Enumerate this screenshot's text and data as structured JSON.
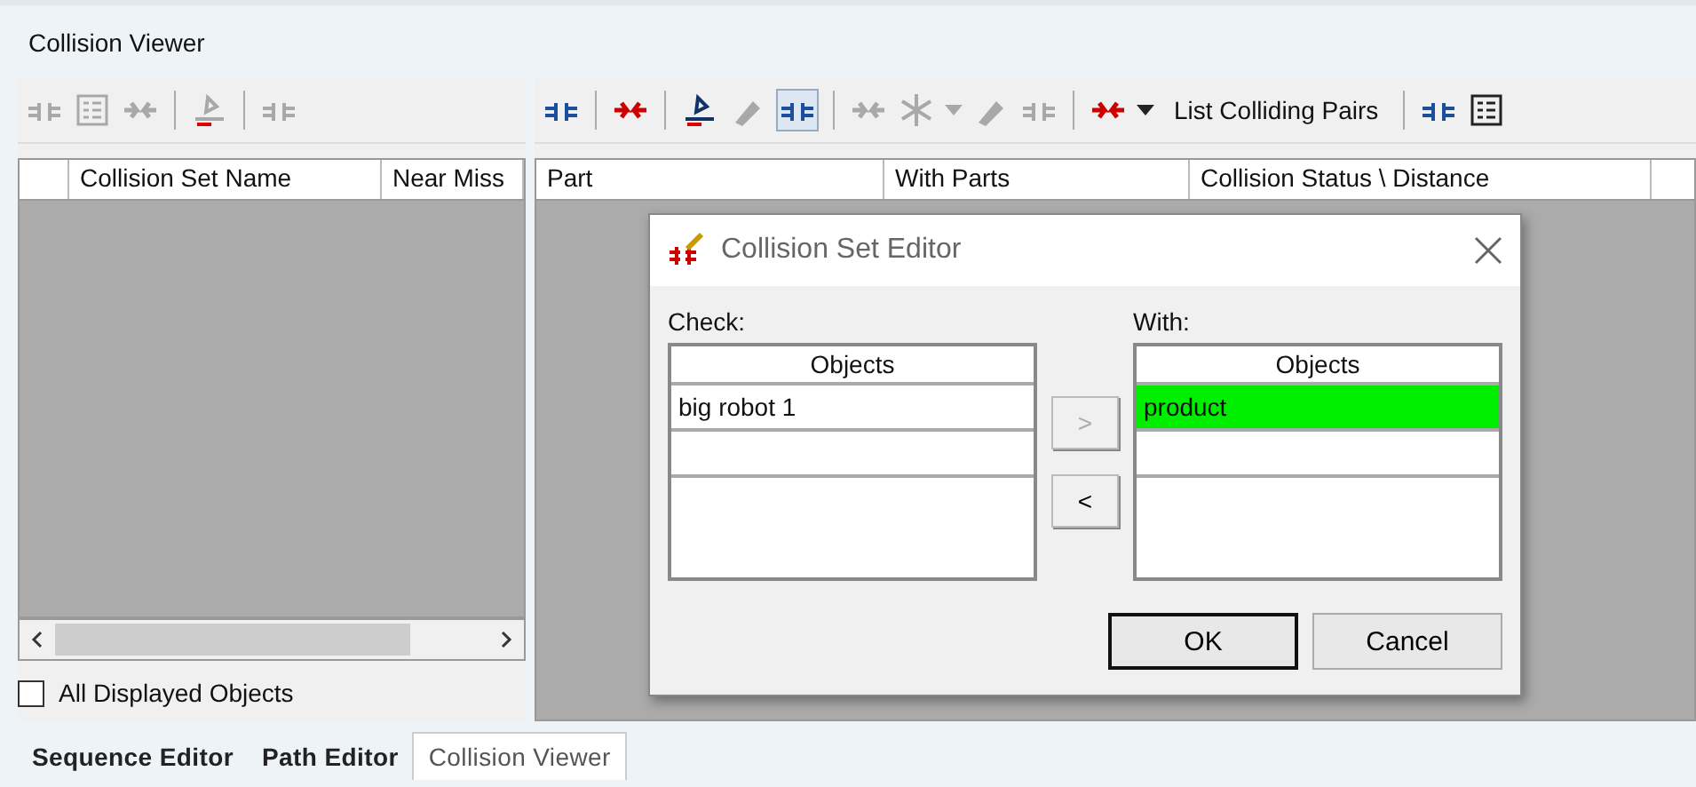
{
  "title": "Collision Viewer",
  "left_toolbar": [
    {
      "kind": "icon",
      "disabled": true
    },
    {
      "kind": "icon",
      "disabled": true
    },
    {
      "kind": "icon",
      "disabled": true
    },
    {
      "kind": "separator"
    },
    {
      "kind": "icon",
      "disabled": true
    },
    {
      "kind": "separator"
    },
    {
      "kind": "icon",
      "disabled": true
    }
  ],
  "left_columns": [
    "Collision Set Name",
    "Near Miss"
  ],
  "all_displayed": {
    "label": "All Displayed Objects",
    "checked": false
  },
  "right_toolbar": [
    {
      "kind": "icon",
      "disabled": false,
      "pressed": false
    },
    {
      "kind": "separator"
    },
    {
      "kind": "icon",
      "disabled": false,
      "pressed": false
    },
    {
      "kind": "separator"
    },
    {
      "kind": "icon",
      "disabled": false,
      "pressed": false
    },
    {
      "kind": "icon",
      "disabled": true,
      "pressed": false
    },
    {
      "kind": "icon",
      "disabled": false,
      "pressed": true
    },
    {
      "kind": "separator"
    },
    {
      "kind": "icon",
      "disabled": true,
      "pressed": false
    },
    {
      "kind": "icon",
      "disabled": true,
      "pressed": false
    },
    {
      "kind": "caret",
      "disabled": true
    },
    {
      "kind": "icon",
      "disabled": true,
      "pressed": false
    },
    {
      "kind": "icon",
      "disabled": true,
      "pressed": false
    },
    {
      "kind": "separator"
    },
    {
      "kind": "icon",
      "disabled": false,
      "pressed": false
    },
    {
      "kind": "caret",
      "disabled": false
    },
    {
      "kind": "text",
      "label": "List Colliding Pairs"
    },
    {
      "kind": "separator"
    },
    {
      "kind": "icon",
      "disabled": false,
      "pressed": false
    },
    {
      "kind": "icon",
      "disabled": false,
      "pressed": false
    }
  ],
  "right_columns": [
    "Part",
    "With Parts",
    "Collision Status \\ Distance"
  ],
  "dialog": {
    "title": "Collision Set Editor",
    "check": {
      "label": "Check:",
      "header": "Objects",
      "rows": [
        {
          "text": "big robot 1",
          "selected": false
        }
      ]
    },
    "with": {
      "label": "With:",
      "header": "Objects",
      "rows": [
        {
          "text": "product",
          "selected": true
        }
      ]
    },
    "move_buttons": [
      {
        "label": ">",
        "disabled": true
      },
      {
        "label": "<",
        "disabled": false
      }
    ],
    "buttons": [
      {
        "label": "OK",
        "default": true
      },
      {
        "label": "Cancel",
        "default": false
      }
    ]
  },
  "tabs": [
    {
      "label": "Sequence Editor",
      "selected": false
    },
    {
      "label": "Path Editor",
      "selected": false
    },
    {
      "label": "Collision Viewer",
      "selected": true
    }
  ]
}
